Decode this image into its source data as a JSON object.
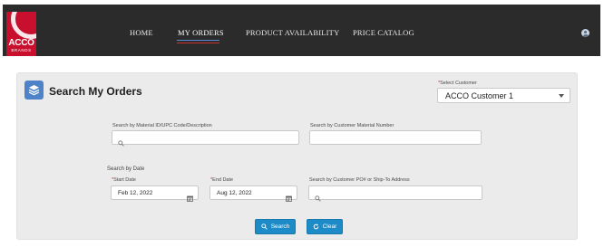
{
  "header": {
    "logo": {
      "word": "ACCO",
      "sub": "BRANDS"
    },
    "nav": [
      {
        "label": "HOME"
      },
      {
        "label": "MY ORDERS",
        "active": true
      },
      {
        "label": "PRODUCT AVAILABILITY"
      },
      {
        "label": "PRICE CATALOG"
      }
    ],
    "user_icon": "user-icon"
  },
  "panel": {
    "title": "Search My Orders",
    "icon": "stack-layers-icon",
    "customer": {
      "required_mark": "*",
      "label": "Select Customer",
      "value": "ACCO Customer 1"
    },
    "material_search": {
      "label": "Search by Material ID/UPC Code/Description",
      "value": ""
    },
    "customer_material": {
      "label": "Search by Customer Material Number",
      "value": ""
    },
    "date_section_label": "Search by Date",
    "start_date": {
      "required_mark": "*",
      "label": "Start Date",
      "value": "Feb 12, 2022"
    },
    "end_date": {
      "required_mark": "*",
      "label": "End Date",
      "value": "Aug 12, 2022"
    },
    "po_search": {
      "label": "Search by Customer PO# or Ship-To Address",
      "value": ""
    },
    "buttons": {
      "search": "Search",
      "clear": "Clear"
    }
  },
  "colors": {
    "header_bg": "#2b2b2b",
    "logo_red": "#c8102e",
    "accent_blue": "#1d8bc7",
    "panel_bg": "#ebebeb",
    "required": "#c23934"
  }
}
